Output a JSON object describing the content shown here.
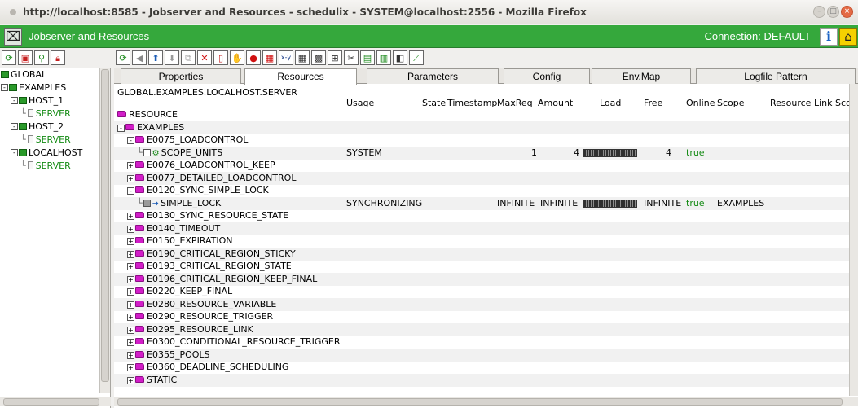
{
  "window": {
    "title": "http://localhost:8585 - Jobserver and Resources - schedulix - SYSTEM@localhost:2556 - Mozilla Firefox"
  },
  "app": {
    "title": "Jobserver and Resources",
    "connection": "Connection: DEFAULT"
  },
  "left_tree": [
    {
      "label": "GLOBAL",
      "level": 0,
      "kind": "group",
      "fold": ""
    },
    {
      "label": "EXAMPLES",
      "level": 0,
      "kind": "group",
      "fold": "-"
    },
    {
      "label": "HOST_1",
      "level": 1,
      "kind": "group",
      "fold": "-"
    },
    {
      "label": "SERVER",
      "level": 2,
      "kind": "server",
      "fold": ""
    },
    {
      "label": "HOST_2",
      "level": 1,
      "kind": "group",
      "fold": "-"
    },
    {
      "label": "SERVER",
      "level": 2,
      "kind": "server",
      "fold": ""
    },
    {
      "label": "LOCALHOST",
      "level": 1,
      "kind": "group",
      "fold": "-"
    },
    {
      "label": "SERVER",
      "level": 2,
      "kind": "server",
      "fold": ""
    }
  ],
  "tabs": [
    "Properties",
    "Resources",
    "Parameters",
    "Config",
    "Env.Map",
    "Logfile Pattern"
  ],
  "active_tab": "Resources",
  "path": "GLOBAL.EXAMPLES.LOCALHOST.SERVER",
  "columns": {
    "usage": "Usage",
    "state": "State",
    "timestamp": "Timestamp",
    "maxreq": "MaxReq",
    "amount": "Amount",
    "load": "Load",
    "free": "Free",
    "online": "Online",
    "scope": "Scope",
    "resource_link_scope": "Resource Link Scope"
  },
  "resources": [
    {
      "name": "RESOURCE",
      "level": 0,
      "fold": "",
      "kind": "folder"
    },
    {
      "name": "EXAMPLES",
      "level": 0,
      "fold": "-",
      "kind": "folder"
    },
    {
      "name": "E0075_LOADCONTROL",
      "level": 1,
      "fold": "-",
      "kind": "folder"
    },
    {
      "name": "SCOPE_UNITS",
      "level": 2,
      "fold": "",
      "kind": "resource",
      "usage": "SYSTEM",
      "maxreq": "1",
      "amount": "4",
      "load": 1.0,
      "free": "4",
      "online": "true"
    },
    {
      "name": "E0076_LOADCONTROL_KEEP",
      "level": 1,
      "fold": "+",
      "kind": "folder"
    },
    {
      "name": "E0077_DETAILED_LOADCONTROL",
      "level": 1,
      "fold": "+",
      "kind": "folder"
    },
    {
      "name": "E0120_SYNC_SIMPLE_LOCK",
      "level": 1,
      "fold": "-",
      "kind": "folder"
    },
    {
      "name": "SIMPLE_LOCK",
      "level": 2,
      "fold": "",
      "kind": "lock",
      "usage": "SYNCHRONIZING",
      "maxreq": "INFINITE",
      "amount": "INFINITE",
      "load": 1.0,
      "free": "INFINITE",
      "online": "true",
      "scope": "EXAMPLES"
    },
    {
      "name": "E0130_SYNC_RESOURCE_STATE",
      "level": 1,
      "fold": "+",
      "kind": "folder"
    },
    {
      "name": "E0140_TIMEOUT",
      "level": 1,
      "fold": "+",
      "kind": "folder"
    },
    {
      "name": "E0150_EXPIRATION",
      "level": 1,
      "fold": "+",
      "kind": "folder"
    },
    {
      "name": "E0190_CRITICAL_REGION_STICKY",
      "level": 1,
      "fold": "+",
      "kind": "folder"
    },
    {
      "name": "E0193_CRITICAL_REGION_STATE",
      "level": 1,
      "fold": "+",
      "kind": "folder"
    },
    {
      "name": "E0196_CRITICAL_REGION_KEEP_FINAL",
      "level": 1,
      "fold": "+",
      "kind": "folder"
    },
    {
      "name": "E0220_KEEP_FINAL",
      "level": 1,
      "fold": "+",
      "kind": "folder"
    },
    {
      "name": "E0280_RESOURCE_VARIABLE",
      "level": 1,
      "fold": "+",
      "kind": "folder"
    },
    {
      "name": "E0290_RESOURCE_TRIGGER",
      "level": 1,
      "fold": "+",
      "kind": "folder"
    },
    {
      "name": "E0295_RESOURCE_LINK",
      "level": 1,
      "fold": "+",
      "kind": "folder"
    },
    {
      "name": "E0300_CONDITIONAL_RESOURCE_TRIGGER",
      "level": 1,
      "fold": "+",
      "kind": "folder"
    },
    {
      "name": "E0355_POOLS",
      "level": 1,
      "fold": "+",
      "kind": "folder"
    },
    {
      "name": "E0360_DEADLINE_SCHEDULING",
      "level": 1,
      "fold": "+",
      "kind": "folder"
    },
    {
      "name": "STATIC",
      "level": 1,
      "fold": "+",
      "kind": "folder"
    }
  ],
  "colors": {
    "app_bar": "#35a83c",
    "folder": "#d21ec8",
    "online_true": "#138a13"
  }
}
